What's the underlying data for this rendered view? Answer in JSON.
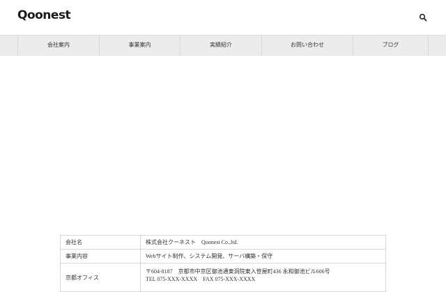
{
  "header": {
    "logo_text": "Qoonest",
    "search_icon": "search-icon"
  },
  "nav": {
    "items": [
      {
        "label": "会社案内"
      },
      {
        "label": "事業案内"
      },
      {
        "label": "実績紹介"
      },
      {
        "label": "お問い合わせ"
      },
      {
        "label": "ブログ"
      }
    ]
  },
  "company_table": {
    "rows": [
      {
        "label": "会社名",
        "value": "株式会社クーネスト　Qoonest Co.,ltd."
      },
      {
        "label": "事業内容",
        "value": "Webサイト制作、システム開発、サーバ構築・保守"
      },
      {
        "label": "京都オフィス",
        "value": "〒604-8187　京都市中京区御池通東洞院東入笹屋町436 永和御池ビル606号",
        "value_line2": "TEL 075-XXX-XXXX　FAX 075-XXX-XXXX"
      }
    ]
  },
  "colors": {
    "nav_background": "#ececec",
    "text": "#222222",
    "border": "#d4d4d4"
  }
}
